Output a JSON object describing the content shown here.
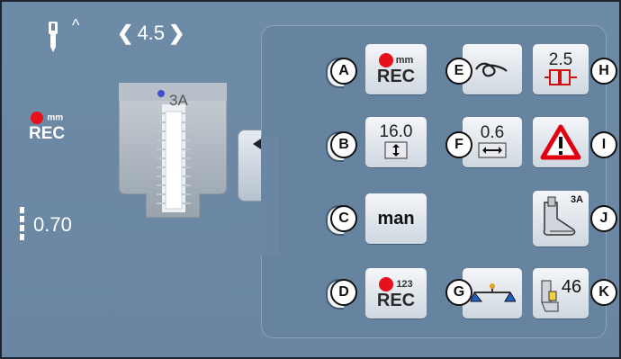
{
  "header": {
    "stitch_width": "4.5",
    "caret": "^"
  },
  "left": {
    "rec": {
      "unit": "mm",
      "label": "REC"
    },
    "stitch_length": "0.70",
    "foot_code": "3A"
  },
  "buttons": [
    {
      "id": "A",
      "name": "rec-mm",
      "unit": "mm",
      "label": "REC"
    },
    {
      "id": "B",
      "name": "buttonhole-length",
      "value": "16.0"
    },
    {
      "id": "C",
      "name": "manual",
      "label": "man"
    },
    {
      "id": "D",
      "name": "rec-123",
      "unit": "123",
      "label": "REC"
    },
    {
      "id": "E",
      "name": "securing"
    },
    {
      "id": "F",
      "name": "slit-width",
      "value": "0.6"
    },
    {
      "id": "G",
      "name": "balance"
    },
    {
      "id": "H",
      "name": "stitch-count",
      "value": "2.5"
    },
    {
      "id": "I",
      "name": "warning"
    },
    {
      "id": "J",
      "name": "presser-foot",
      "value": "3A"
    },
    {
      "id": "K",
      "name": "presser-foot-pressure",
      "value": "46"
    }
  ],
  "colors": {
    "rec_red": "#e8101a",
    "background": "#6d8aa6",
    "info_blue": "#1a4f9a"
  }
}
